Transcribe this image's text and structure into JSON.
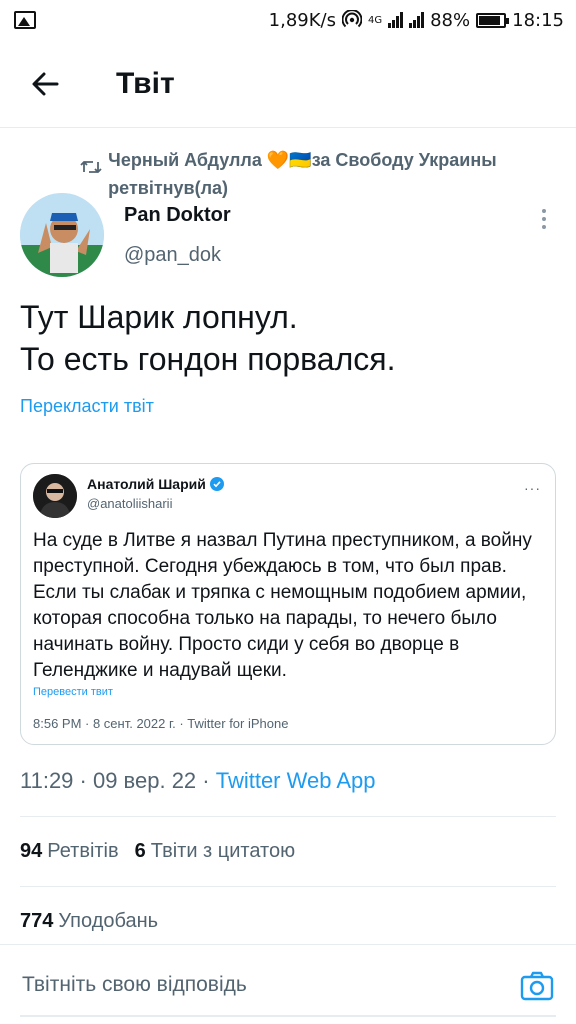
{
  "status_bar": {
    "speed": "1,89K/s",
    "network_label": "4G",
    "battery_pct": "88%",
    "battery_level": 0.88,
    "time": "18:15"
  },
  "header": {
    "title": "Твіт"
  },
  "retweet": {
    "text": "Черный Абдулла 🧡🇺🇦за Свободу Украины ретвітнув(ла)"
  },
  "author": {
    "name": "Pan Doktor",
    "handle": "@pan_dok"
  },
  "tweet": {
    "text": "Тут Шарик лопнул.\nТо есть гондон порвался.",
    "translate_label": "Перекласти твіт",
    "meta_time": "11:29 · 09 вер. 22 · ",
    "meta_app": "Twitter Web App"
  },
  "quoted": {
    "name": "Анатолий Шарий",
    "handle": "@anatoliisharii",
    "more": "···",
    "text": "На суде в Литве я назвал Путина преступником, а войну преступной. Сегодня убеждаюсь в том, что был прав. Если ты слабак и тряпка с немощным подобием армии, которая способна только на парады, то нечего было начинать войну. Просто сиди у себя во дворце в Геленджике и надувай щеки.",
    "translate_label": "Перевести твит",
    "meta": "8:56 PM · 8 сент. 2022 г. · Twitter for iPhone"
  },
  "stats": {
    "retweets_count": "94",
    "retweets_label": "Ретвітів",
    "quotes_count": "6",
    "quotes_label": "Твіти з цитатою",
    "likes_count": "774",
    "likes_label": "Уподобань"
  },
  "reply": {
    "placeholder": "Твітніть свою відповідь"
  },
  "colors": {
    "accent": "#1d9bf0",
    "secondary_text": "#536471",
    "primary_text": "#0f1419"
  }
}
